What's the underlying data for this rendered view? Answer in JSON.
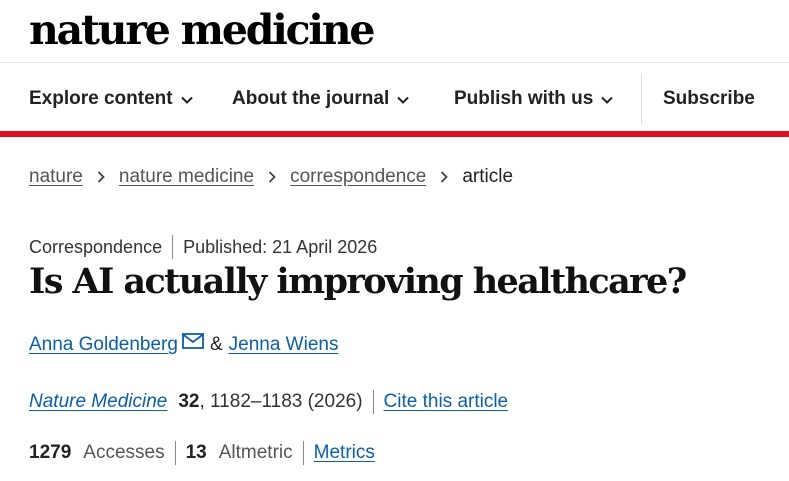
{
  "brand": {
    "logo_text": "nature medicine"
  },
  "nav": {
    "items": [
      {
        "label": "Explore content",
        "has_dropdown": true
      },
      {
        "label": "About the journal",
        "has_dropdown": true
      },
      {
        "label": "Publish with us",
        "has_dropdown": true
      },
      {
        "label": "Subscribe",
        "has_dropdown": false
      }
    ]
  },
  "breadcrumb": {
    "links": [
      "nature",
      "nature medicine",
      "correspondence"
    ],
    "current": "article"
  },
  "article": {
    "type": "Correspondence",
    "published": "Published: 21 April 2026",
    "title": "Is AI actually improving healthcare?",
    "authors": [
      {
        "name": "Anna Goldenberg",
        "email_icon": true
      },
      {
        "name": "Jenna Wiens"
      }
    ],
    "author_separator": "&",
    "citation": {
      "journal": "Nature Medicine",
      "volume": "32",
      "pages_year": ", 1182–1183 (2026)",
      "cite_label": "Cite this article"
    },
    "metrics": {
      "accesses_count": "1279",
      "accesses_label": "Accesses",
      "altmetric_count": "13",
      "altmetric_label": "Altmetric",
      "metrics_link": "Metrics"
    }
  },
  "colors": {
    "accent_red": "#e0101e",
    "link_blue": "#0b5ea8"
  },
  "icons": [
    "chevron-down-icon",
    "chevron-right-icon",
    "mail-icon"
  ]
}
